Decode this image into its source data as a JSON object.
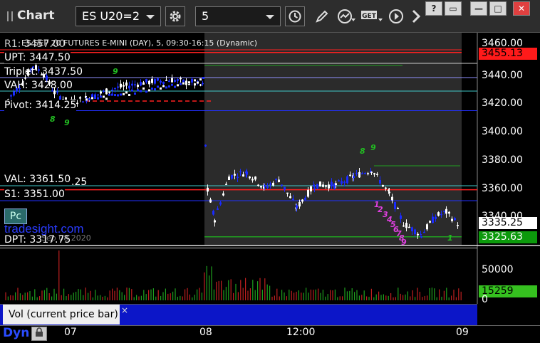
{
  "app": {
    "title": "Chart"
  },
  "toolbar": {
    "symbol": "ES U20=2",
    "interval": "5",
    "get_label": "GET"
  },
  "window_buttons": {
    "help": "?",
    "restore": "▭",
    "minimize": "—",
    "maximize": "□",
    "close": "✕"
  },
  "chart": {
    "series_title": "ES SEP 20 FUTURES E-MINI (DAY), 5, 09:30-16:15 (Dynamic)",
    "price_axis": [
      "3460.00",
      "3440.00",
      "3420.00",
      "3400.00",
      "3380.00",
      "3360.00",
      "3340.00"
    ],
    "current_price": "3335.25",
    "price_box_red": "3455.13",
    "price_box_green": "3325.63",
    "levels": {
      "upt": "UPT: 3447.50",
      "triplet": "Triplet: 3437.50",
      "vah": "VAH: 3428.00",
      "pivot": "Pivot: 3414.25",
      "val": "VAL: 3361.50",
      "s1": "S1: 3351.00",
      "dpt": "DPT: 3317.75",
      "r1_fragment": "R1: 3457.00",
      "val_fragment": ".25"
    },
    "pc_badge": "Pc",
    "brand": "tradesight.com",
    "date_overlay": "Sep 08 2020",
    "td_labels": [
      "8",
      "9",
      "9",
      "8",
      "1",
      "2",
      "3",
      "4",
      "5",
      "6",
      "7",
      "8",
      "9"
    ]
  },
  "volume": {
    "axis": [
      "50000",
      "0"
    ],
    "current": "15259",
    "tab_label": "Vol (current price bar)",
    "close_glyph": "×"
  },
  "time_axis": {
    "dyn_label": "Dyn",
    "labels": [
      "07",
      "08",
      "12:00",
      "09"
    ]
  },
  "colors": {
    "up_bar": "#ffffff",
    "down_bar": "#1a2bff",
    "red_level": "#ff2020",
    "green_level": "#20a020",
    "blue_level": "#2230ff",
    "cyan_level": "#40c8c8",
    "volume_up": "#1ea01e",
    "volume_down": "#c02020",
    "current_price_box": "#ffffff",
    "red_box": "#ff1a1a",
    "green_box": "#0c9a0c"
  }
}
